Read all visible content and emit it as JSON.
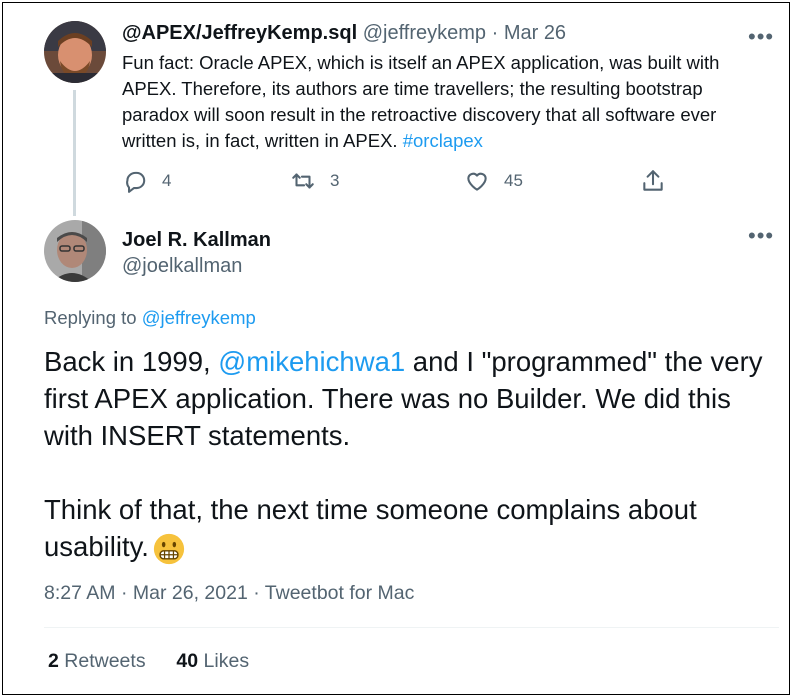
{
  "parent_tweet": {
    "display_name": "@APEX/JeffreyKemp.sql",
    "handle": "@jeffreykemp",
    "separator": "·",
    "date": "Mar 26",
    "text_before_hashtag": "Fun fact: Oracle APEX, which is itself an APEX application, was built with APEX. Therefore, its authors are time travellers; the resulting bootstrap paradox will soon result in the retroactive discovery that all software ever written is, in fact, written in APEX.",
    "hashtag": "#orclapex",
    "more_label": "•••",
    "actions": {
      "replies": "4",
      "retweets": "3",
      "likes": "45"
    },
    "icons": [
      "reply-icon",
      "retweet-icon",
      "like-icon",
      "share-icon"
    ]
  },
  "main_tweet": {
    "display_name": "Joel R. Kallman",
    "handle": "@joelkallman",
    "more_label": "•••",
    "replying_prefix": "Replying to",
    "replying_handle": "@jeffreykemp",
    "para1_before_mention": "Back in 1999,",
    "mention": "@mikehichwa1",
    "para1_after_mention": "and I \"programmed\" the very first APEX application.  There was no Builder.  We did this with INSERT statements.",
    "para2": "Think of that, the next time someone complains about usability.",
    "emoji": "grimacing-face-emoji",
    "time": "8:27 AM",
    "date": "Mar 26, 2021",
    "source": "Tweetbot for Mac",
    "meta_separator": "·",
    "stats": {
      "retweets_count": "2",
      "retweets_label": "Retweets",
      "likes_count": "40",
      "likes_label": "Likes"
    }
  },
  "colors": {
    "link": "#1d9bf0",
    "muted": "#536471",
    "text": "#0f1419",
    "emoji_face": "#f6c23c"
  }
}
